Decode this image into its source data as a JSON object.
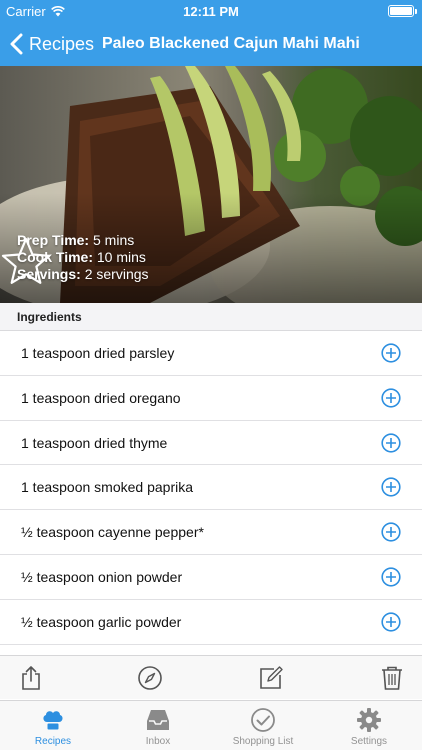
{
  "status_bar": {
    "carrier": "Carrier",
    "time": "12:11 PM"
  },
  "nav": {
    "back_label": "Recipes",
    "title": "Paleo Blackened Cajun Mahi Mahi"
  },
  "recipe": {
    "prep_label": "Prep Time:",
    "prep_value": "5 mins",
    "cook_label": "Cook Time:",
    "cook_value": "10 mins",
    "servings_label": "Servings:",
    "servings_value": "2 servings",
    "favorite_icon": "star-outline-icon"
  },
  "ingredients": {
    "header": "Ingredients",
    "items": [
      "1 teaspoon dried parsley",
      "1 teaspoon dried oregano",
      "1 teaspoon dried thyme",
      "1 teaspoon smoked paprika",
      "½ teaspoon cayenne pepper*",
      "½ teaspoon onion powder",
      "½ teaspoon garlic powder"
    ],
    "add_icon": "plus-circle-icon"
  },
  "toolbar": {
    "icons": [
      "share-icon",
      "compass-icon",
      "edit-icon",
      "trash-icon"
    ]
  },
  "tabs": [
    {
      "label": "Recipes",
      "icon": "chef-hat-icon",
      "active": true
    },
    {
      "label": "Inbox",
      "icon": "inbox-tray-icon",
      "active": false
    },
    {
      "label": "Shopping List",
      "icon": "checkmark-circle-icon",
      "active": false
    },
    {
      "label": "Settings",
      "icon": "gear-icon",
      "active": false
    }
  ],
  "colors": {
    "accent": "#3a9ee8",
    "tab_active": "#2d8fe0",
    "icon_gray": "#555555"
  }
}
